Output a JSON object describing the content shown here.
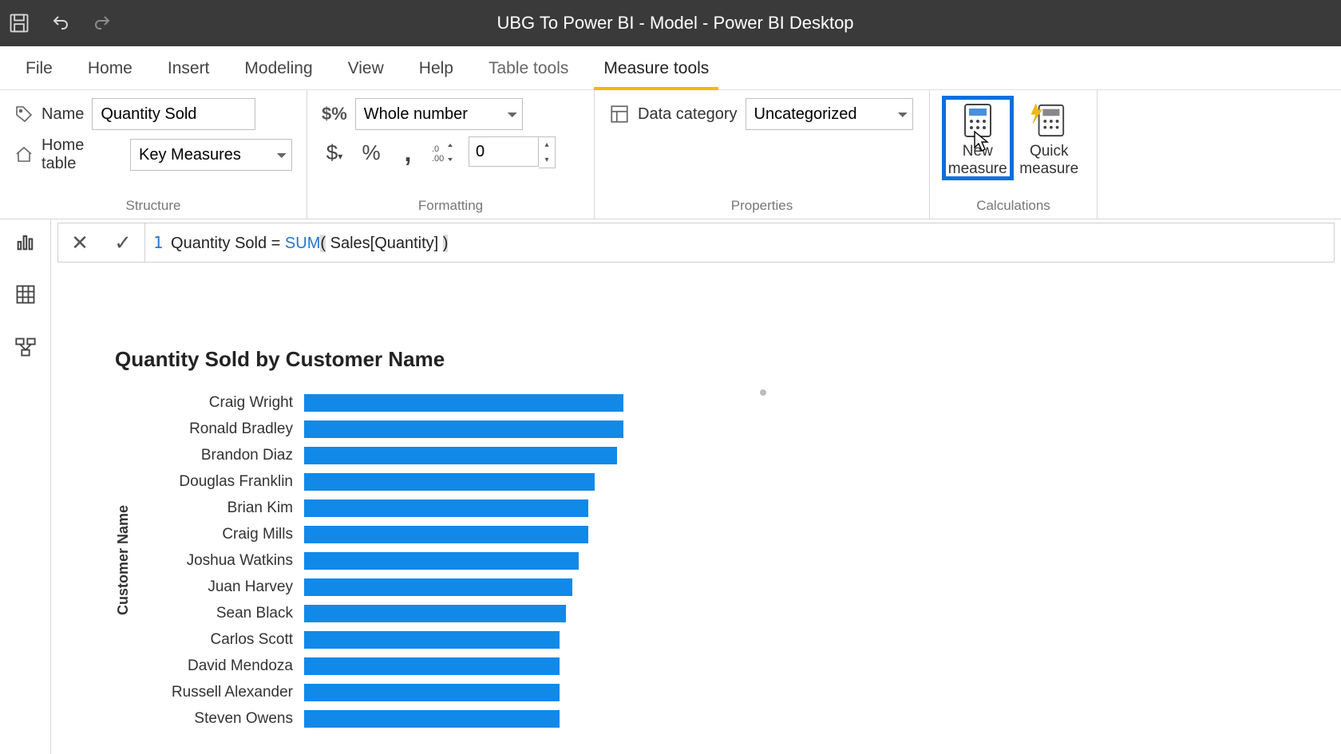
{
  "titlebar": {
    "title": "UBG To Power BI - Model - Power BI Desktop"
  },
  "tabs": {
    "file": "File",
    "home": "Home",
    "insert": "Insert",
    "modeling": "Modeling",
    "view": "View",
    "help": "Help",
    "table_tools": "Table tools",
    "measure_tools": "Measure tools"
  },
  "ribbon": {
    "structure": {
      "name_label": "Name",
      "name_value": "Quantity Sold",
      "home_table_label": "Home table",
      "home_table_value": "Key Measures",
      "group_label": "Structure"
    },
    "formatting": {
      "format_value": "Whole number",
      "decimals_value": "0",
      "group_label": "Formatting"
    },
    "properties": {
      "data_category_label": "Data category",
      "data_category_value": "Uncategorized",
      "group_label": "Properties"
    },
    "calculations": {
      "new_measure": "New measure",
      "quick_measure": "Quick measure",
      "group_label": "Calculations"
    }
  },
  "formula": {
    "line_no": "1",
    "measure_name": "Quantity Sold",
    "equals": " = ",
    "fn": "SUM",
    "open": "(",
    "arg": " Sales[Quantity] ",
    "close": ")"
  },
  "chart_data": {
    "type": "bar",
    "title": "Quantity Sold by Customer Name",
    "ylabel": "Customer Name",
    "xlabel": "",
    "xmax": 100,
    "categories": [
      "Craig Wright",
      "Ronald Bradley",
      "Brandon Diaz",
      "Douglas Franklin",
      "Brian Kim",
      "Craig Mills",
      "Joshua Watkins",
      "Juan Harvey",
      "Sean Black",
      "Carlos Scott",
      "David Mendoza",
      "Russell Alexander",
      "Steven Owens"
    ],
    "values": [
      100,
      100,
      98,
      91,
      89,
      89,
      86,
      84,
      82,
      80,
      80,
      80,
      80
    ]
  }
}
